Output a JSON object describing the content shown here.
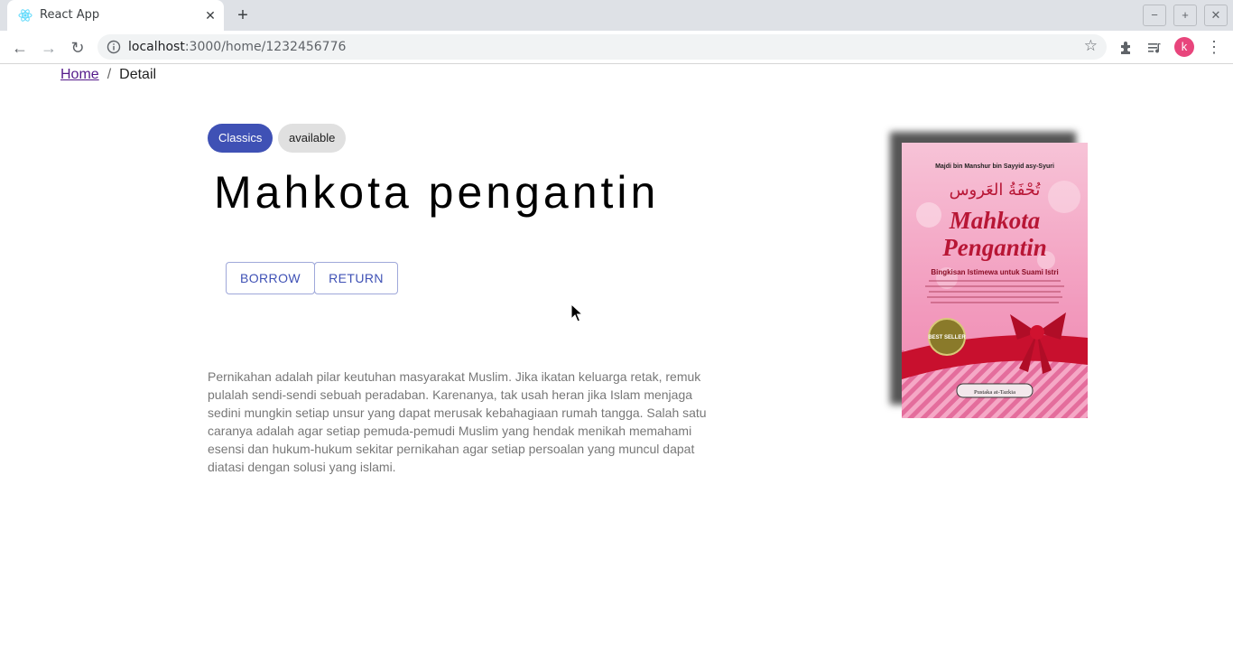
{
  "browser": {
    "tab_title": "React App",
    "url_host": "localhost",
    "url_path": ":3000/home/1232456776",
    "profile_initial": "k"
  },
  "breadcrumb": {
    "home": "Home",
    "separator": "/",
    "current": "Detail"
  },
  "book": {
    "category": "Classics",
    "status": "available",
    "title": "Mahkota pengantin",
    "description": "Pernikahan adalah pilar keutuhan masyarakat Muslim. Jika ikatan keluarga retak, remuk pulalah sendi-sendi sebuah peradaban. Karenanya, tak usah heran jika Islam menjaga sedini mungkin setiap unsur yang dapat merusak kebahagiaan rumah tangga. Salah satu caranya adalah agar setiap pemuda-pemudi Muslim yang hendak menikah memahami esensi dan hukum-hukum sekitar pernikahan agar setiap persoalan yang muncul dapat diatasi dengan solusi yang islami."
  },
  "actions": {
    "borrow": "Borrow",
    "return": "Return"
  },
  "cover": {
    "author": "Majdi bin Manshur bin Sayyid asy-Syuri",
    "title_line1": "Mahkota",
    "title_line2": "Pengantin",
    "subtitle": "Bingkisan Istimewa untuk Suami Istri",
    "badge": "BEST SELLER",
    "publisher": "Pustaka at-Tazkia"
  },
  "colors": {
    "primary": "#3f51b5",
    "chip_default": "#e0e0e0",
    "cover_pink": "#f2a3c2",
    "ribbon_red": "#c8102e"
  }
}
